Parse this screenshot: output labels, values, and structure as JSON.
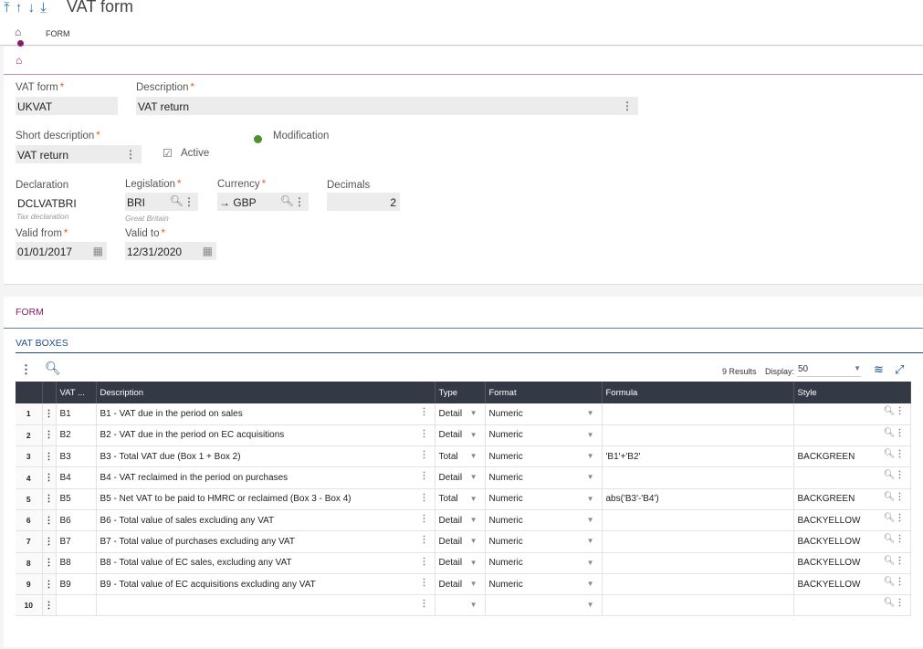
{
  "header": {
    "arrows": "⤒ ↑ ↓ ⤓",
    "title": "VAT form"
  },
  "tabs": {
    "form": "FORM"
  },
  "fields": {
    "vat_form": {
      "label": "VAT form",
      "value": "UKVAT"
    },
    "description": {
      "label": "Description",
      "value": "VAT return"
    },
    "short_description": {
      "label": "Short description",
      "value": "VAT return"
    },
    "active": {
      "label": "Active",
      "checked": true
    },
    "modification": {
      "label": "Modification"
    },
    "declaration": {
      "label": "Declaration",
      "value": "DCLVATBRI",
      "sub": "Tax declaration"
    },
    "legislation": {
      "label": "Legislation",
      "value": "BRI",
      "sub": "Great Britain"
    },
    "currency": {
      "label": "Currency",
      "value": "→ GBP"
    },
    "decimals": {
      "label": "Decimals",
      "value": "2"
    },
    "valid_from": {
      "label": "Valid from",
      "value": "01/01/2017"
    },
    "valid_to": {
      "label": "Valid to",
      "value": "12/31/2020"
    }
  },
  "section": {
    "title": "FORM",
    "subtitle": "VAT BOXES"
  },
  "grid": {
    "results": "9 Results",
    "display_label": "Display:",
    "display_value": "50",
    "columns": [
      "VAT ...",
      "Description",
      "Type",
      "Format",
      "Formula",
      "Style"
    ],
    "rows": [
      {
        "n": "1",
        "code": "B1",
        "desc": "B1 - VAT due in the period on sales",
        "type": "Detail",
        "format": "Numeric",
        "formula": "",
        "style": ""
      },
      {
        "n": "2",
        "code": "B2",
        "desc": "B2 - VAT due in the period on EC acquisitions",
        "type": "Detail",
        "format": "Numeric",
        "formula": "",
        "style": ""
      },
      {
        "n": "3",
        "code": "B3",
        "desc": "B3 - Total VAT due (Box 1 + Box 2)",
        "type": "Total",
        "format": "Numeric",
        "formula": "'B1'+'B2'",
        "style": "BACKGREEN"
      },
      {
        "n": "4",
        "code": "B4",
        "desc": "B4 - VAT reclaimed in the period on purchases",
        "type": "Detail",
        "format": "Numeric",
        "formula": "",
        "style": ""
      },
      {
        "n": "5",
        "code": "B5",
        "desc": "B5 - Net VAT to be paid to HMRC or reclaimed (Box 3 - Box 4)",
        "type": "Total",
        "format": "Numeric",
        "formula": "abs('B3'-'B4')",
        "style": "BACKGREEN"
      },
      {
        "n": "6",
        "code": "B6",
        "desc": "B6 - Total value of sales excluding any VAT",
        "type": "Detail",
        "format": "Numeric",
        "formula": "",
        "style": "BACKYELLOW"
      },
      {
        "n": "7",
        "code": "B7",
        "desc": "B7 - Total value of purchases excluding any VAT",
        "type": "Detail",
        "format": "Numeric",
        "formula": "",
        "style": "BACKYELLOW"
      },
      {
        "n": "8",
        "code": "B8",
        "desc": "B8 - Total value of EC sales, excluding any VAT",
        "type": "Detail",
        "format": "Numeric",
        "formula": "",
        "style": "BACKYELLOW"
      },
      {
        "n": "9",
        "code": "B9",
        "desc": "B9 - Total value of EC acquisitions excluding any VAT",
        "type": "Detail",
        "format": "Numeric",
        "formula": "",
        "style": "BACKYELLOW"
      },
      {
        "n": "10",
        "code": "",
        "desc": "",
        "type": "",
        "format": "",
        "formula": "",
        "style": ""
      }
    ]
  },
  "colors": {
    "accent": "#8a1c6a",
    "required": "#e35f1f",
    "header_bg": "#333a45",
    "link_blue": "#1e4f84"
  }
}
